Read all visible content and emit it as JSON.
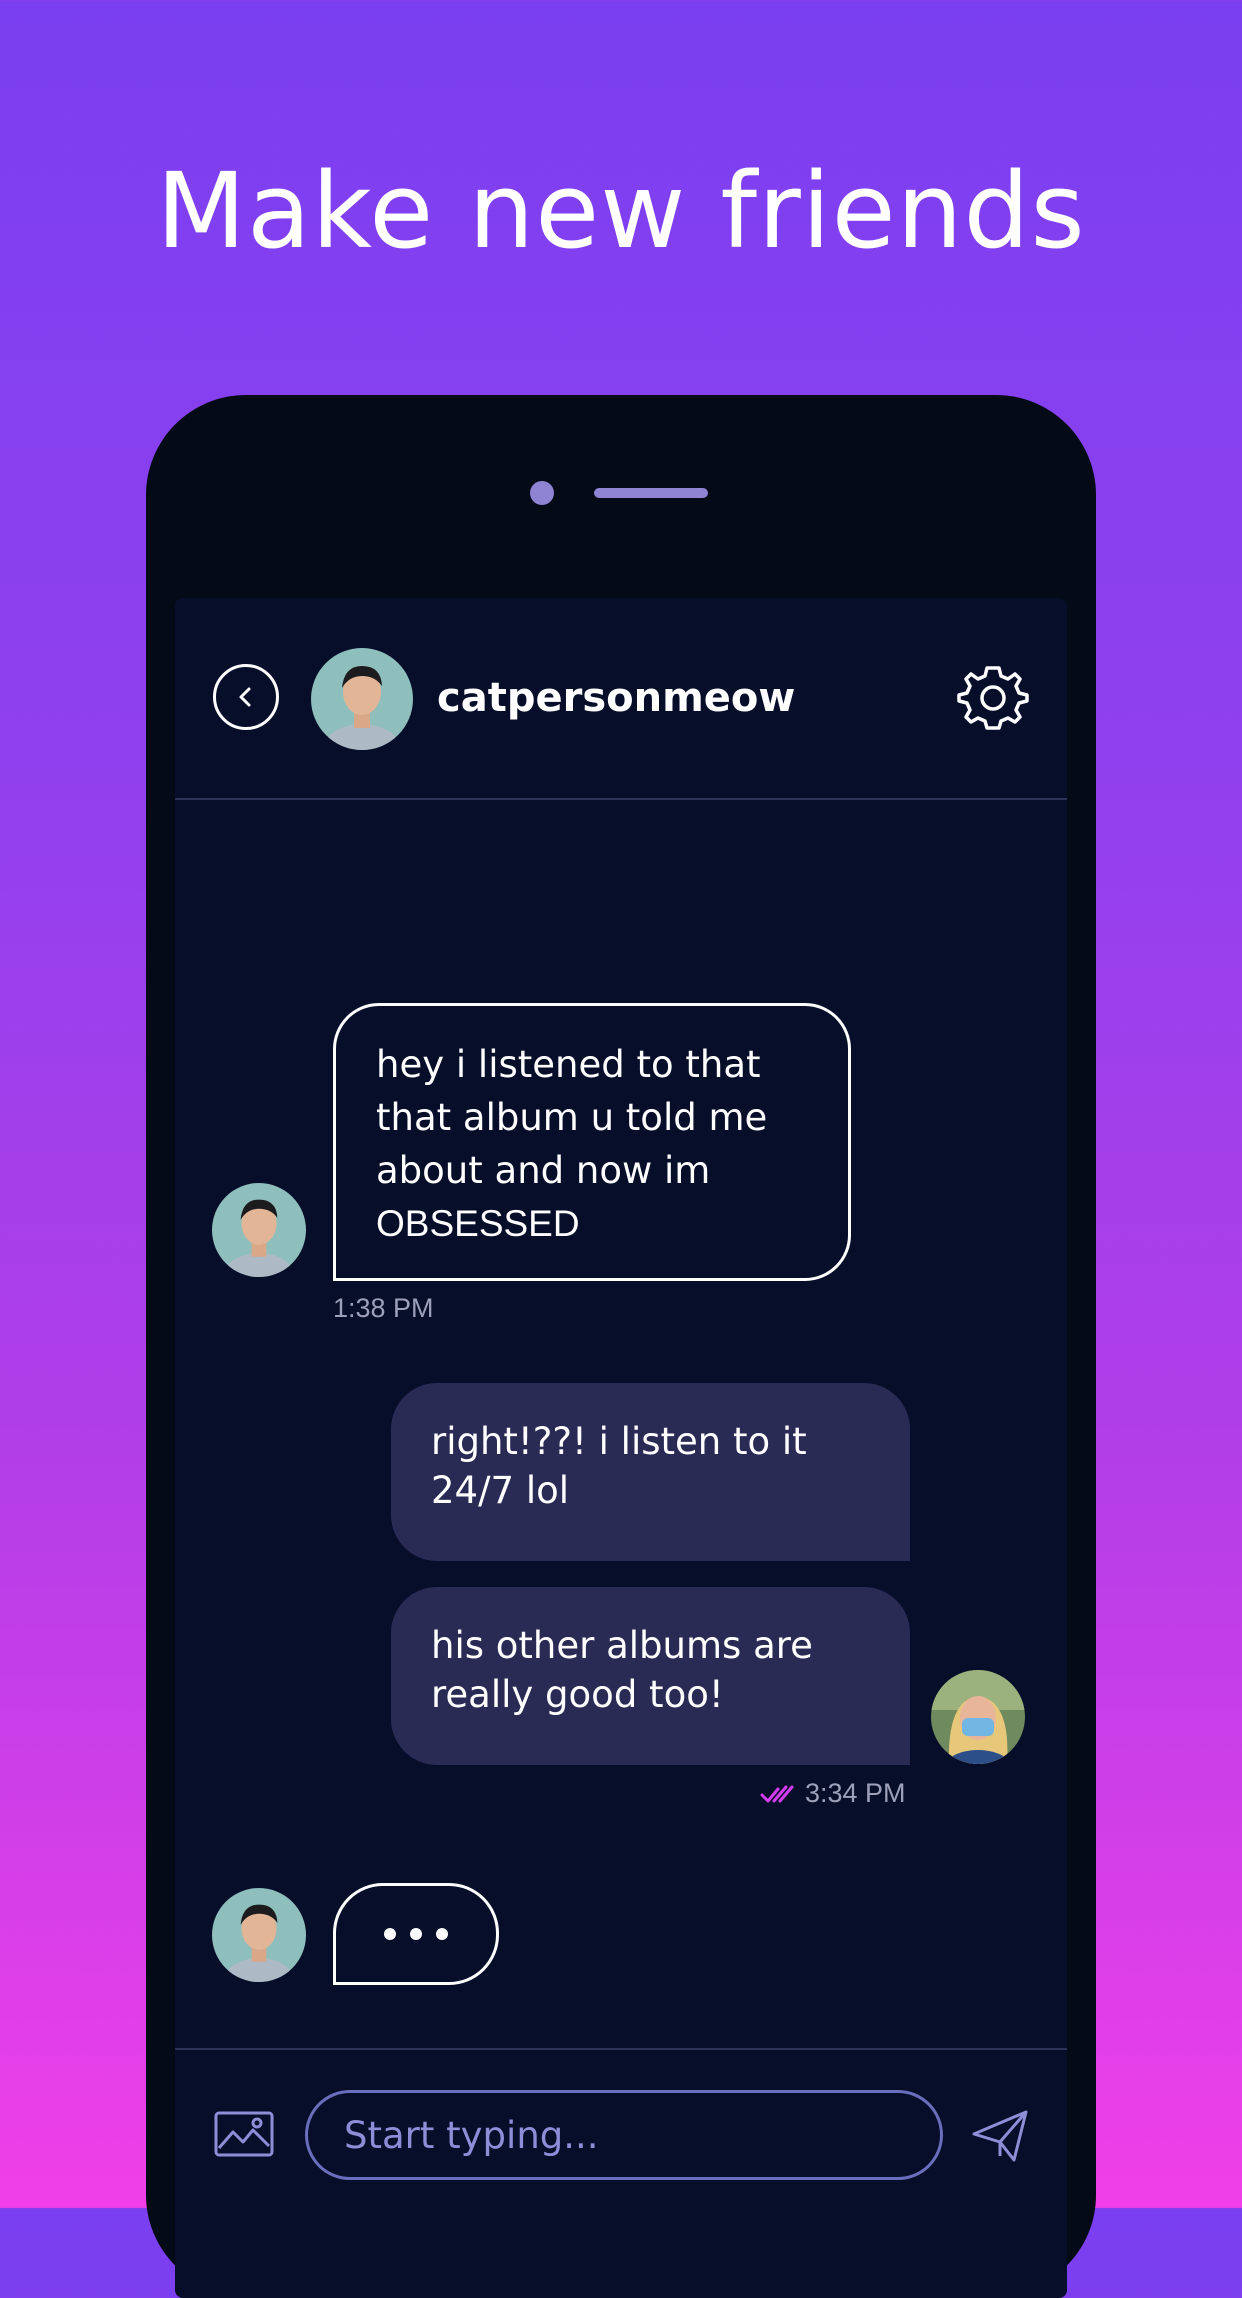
{
  "headline": "Make new friends",
  "chat": {
    "username": "catpersonmeow",
    "messages": [
      {
        "sender": "other",
        "text_lines": [
          "hey i listened to that",
          "that album u told me",
          "about and now im",
          "OBSESSED"
        ],
        "time": "1:38 PM"
      },
      {
        "sender": "me",
        "text_lines": [
          "right!??! i listen to it",
          "24/7 lol"
        ]
      },
      {
        "sender": "me",
        "text_lines": [
          "his other albums are",
          "really good too!"
        ],
        "time": "3:34 PM",
        "status": "read"
      }
    ],
    "typing_indicator": "..."
  },
  "composer": {
    "placeholder": "Start typing..."
  },
  "colors": {
    "accent": "#d43cf0",
    "bubble_out": "#2a2b55",
    "screen_bg": "#070e2a",
    "phone_body": "#050a17"
  },
  "icons": [
    "chevron-left-icon",
    "gear-icon",
    "image-icon",
    "send-icon",
    "double-check-icon"
  ]
}
